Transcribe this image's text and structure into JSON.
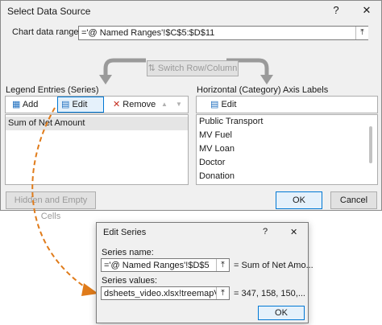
{
  "main": {
    "title": "Select Data Source",
    "help": "?",
    "close": "✕",
    "range_label": "Chart data range:",
    "range_value": "='@ Named Ranges'!$C$5:$D$11",
    "switch_label": "Switch Row/Column",
    "legend_heading": "Legend Entries (Series)",
    "axis_heading": "Horizontal (Category) Axis Labels",
    "add_label": "Add",
    "edit_label": "Edit",
    "remove_label": "Remove",
    "up_icon": "▲",
    "down_icon": "▼",
    "axis_edit_label": "Edit",
    "series": [
      "Sum of Net Amount"
    ],
    "categories": [
      "Public Transport",
      "MV Fuel",
      "MV Loan",
      "Doctor",
      "Donation"
    ],
    "hidden_cells_label": "Hidden and Empty Cells",
    "ok_label": "OK",
    "cancel_label": "Cancel"
  },
  "edit_series": {
    "title": "Edit Series",
    "help": "?",
    "close": "✕",
    "name_label": "Series name:",
    "name_value": "='@ Named Ranges'!$D$5",
    "name_result": "= Sum of Net Amo...",
    "values_label": "Series values:",
    "values_value": "dsheets_video.xlsx!treemapValues",
    "values_result": "= 347, 158, 150,...",
    "ok_label": "OK"
  },
  "colors": {
    "dialog_bg": "#f0f0f0",
    "selection_bg": "#e5e5e5",
    "accent": "#0078d4",
    "arrow": "#e07b1a",
    "close_red": "#e81123"
  }
}
